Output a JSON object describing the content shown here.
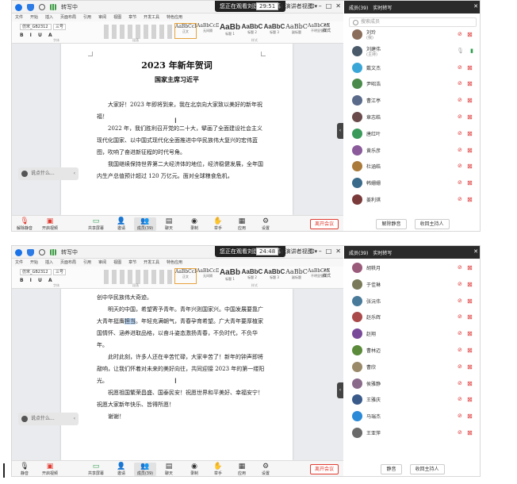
{
  "screens": [
    {
      "recording": "转写中",
      "share_notice": "您正在观看刘建伟的屏幕",
      "timer": "29:51",
      "view_label": "演讲者视图",
      "panel": {
        "members_tab": "成员(39)",
        "transcript_tab": "实时转写",
        "search_placeholder": "搜索成员",
        "members": [
          {
            "name": "刘玲",
            "sub": "(我)",
            "color": "#8a6d5a",
            "mic": "off",
            "cam": "off"
          },
          {
            "name": "刘建伟",
            "sub": "(主持)",
            "color": "#4a5a6a",
            "mic": "on",
            "cam": "off"
          },
          {
            "name": "戴文杰",
            "sub": "",
            "color": "#3aa6d8",
            "mic": "off",
            "cam": "off"
          },
          {
            "name": "尹昭浩",
            "sub": "",
            "color": "#4a8a4a",
            "mic": "off",
            "cam": "off"
          },
          {
            "name": "曹江亭",
            "sub": "",
            "color": "#5a6a8a",
            "mic": "off",
            "cam": "off"
          },
          {
            "name": "章志皓",
            "sub": "",
            "color": "#6a4a4a",
            "mic": "off",
            "cam": "off"
          },
          {
            "name": "唐红叶",
            "sub": "",
            "color": "#3a9a5a",
            "mic": "off",
            "cam": "off"
          },
          {
            "name": "黄乐彦",
            "sub": "",
            "color": "#8a5a9a",
            "mic": "off",
            "cam": "off"
          },
          {
            "name": "杜涵皓",
            "sub": "",
            "color": "#aa7a3a",
            "mic": "off",
            "cam": "off"
          },
          {
            "name": "韩姗姗",
            "sub": "",
            "color": "#3a6a8a",
            "mic": "off",
            "cam": "off"
          },
          {
            "name": "姜利琪",
            "sub": "",
            "color": "#7a3a3a",
            "mic": "off",
            "cam": "off"
          }
        ],
        "footer_buttons": [
          "解除静音",
          "收回主持人"
        ]
      },
      "toolbar": {
        "mic_label": "解除静音",
        "video_label": "开启视频",
        "share_label": "共享屏幕",
        "invite_label": "邀请",
        "members_label": "成员(39)",
        "chat_label": "聊天",
        "record_label": "录制",
        "hand_label": "举手",
        "apps_label": "应用",
        "settings_label": "设置",
        "leave_label": "离开会议"
      },
      "chat_placeholder": "说点什么...",
      "document": {
        "title": "2023 年新年贺词",
        "subtitle": "国家主席习近平",
        "paragraphs": [
          "大家好！2023 年即将到来，我在北京向大家致以美好的新年祝福！",
          "2022 年，我们胜利召开党的二十大，擘画了全面建设社会主义现代化国家、以中国式现代化全面推进中华民族伟大复兴的宏伟蓝图，吹响了奋进新征程的时代号角。",
          "我国继续保持世界第二大经济体的地位，经济稳健发展，全年国内生产总值预计超过 120 万亿元。面对全球粮食危机，"
        ]
      }
    },
    {
      "recording": "转写中",
      "share_notice": "您正在观看刘建伟的屏幕",
      "timer": "24:48",
      "view_label": "演讲者视图",
      "panel": {
        "members_tab": "成员(39)",
        "transcript_tab": "实时转写",
        "members": [
          {
            "name": "胡轶月",
            "color": "#9a5a7a"
          },
          {
            "name": "于佳琳",
            "color": "#7a7a5a"
          },
          {
            "name": "张沅伟",
            "color": "#4a7a9a"
          },
          {
            "name": "赵乐辉",
            "color": "#aa4a4a"
          },
          {
            "name": "赵翔",
            "color": "#7a4a9a"
          },
          {
            "name": "曹林迈",
            "color": "#5a8a3a"
          },
          {
            "name": "曹欣",
            "color": "#9a8a6a"
          },
          {
            "name": "侯雅静",
            "color": "#8a6a8a"
          },
          {
            "name": "王雅庆",
            "color": "#3a5a8a"
          },
          {
            "name": "马瑞杰",
            "color": "#2a8ad8"
          },
          {
            "name": "王亚萍",
            "color": "#6a6a6a"
          }
        ],
        "footer_buttons": [
          "静音",
          "收回主持人"
        ]
      },
      "toolbar": {
        "mic_label": "静音",
        "video_label": "开启视频",
        "share_label": "共享屏幕",
        "invite_label": "邀请",
        "members_label": "成员(39)",
        "chat_label": "聊天",
        "record_label": "录制",
        "hand_label": "举手",
        "apps_label": "应用",
        "settings_label": "设置",
        "leave_label": "离开会议"
      },
      "chat_placeholder": "说点什么...",
      "document": {
        "paragraphs": [
          "创中华民族伟大奇迹。",
          "明天的中国，希望寄予青年。青年兴则国家兴。中国发展要靠广大青年挺膺担当。年轻充满朝气，青春孕育希望。广大青年要厚植家国情怀、涵养进取品格，以奋斗姿态激扬青春，不负时代，不负华年。",
          "此时此刻，许多人还在辛苦忙碌，大家辛苦了！新年的钟声即将敲响，让我们怀着对未来的美好向往，共同迎接 2023 年的第一缕阳光。",
          "祝愿祖国繁荣昌盛、国泰民安！祝愿世界和平美好、幸福安宁！祝愿大家新年快乐、皆得所愿！",
          "谢谢！"
        ],
        "highlight": "担当"
      }
    }
  ],
  "word": {
    "menu": [
      "文件",
      "开始",
      "插入",
      "页面布局",
      "引用",
      "审阅",
      "视图",
      "章节",
      "开发工具",
      "特色应用"
    ],
    "font_name": "仿宋_GB2312",
    "font_size": "三号",
    "styles": [
      {
        "sample": "AaBbCcDd",
        "name": "正文"
      },
      {
        "sample": "AaBbCcDd",
        "name": "无间隔"
      },
      {
        "sample": "AaBb",
        "name": "标题 1"
      },
      {
        "sample": "AaBbC",
        "name": "标题 2"
      },
      {
        "sample": "AaBbC",
        "name": "标题 3"
      },
      {
        "sample": "AaBbC",
        "name": "副标题"
      },
      {
        "sample": "AaBbCcDd",
        "name": "不明显强调"
      }
    ],
    "group_labels": [
      "字体",
      "段落",
      "样式"
    ],
    "tools": [
      "样式",
      "编辑"
    ]
  },
  "colors": {
    "accent_red": "#e03c31",
    "panel_dark": "#2a2a2a",
    "highlight": "#b9d4f2"
  }
}
